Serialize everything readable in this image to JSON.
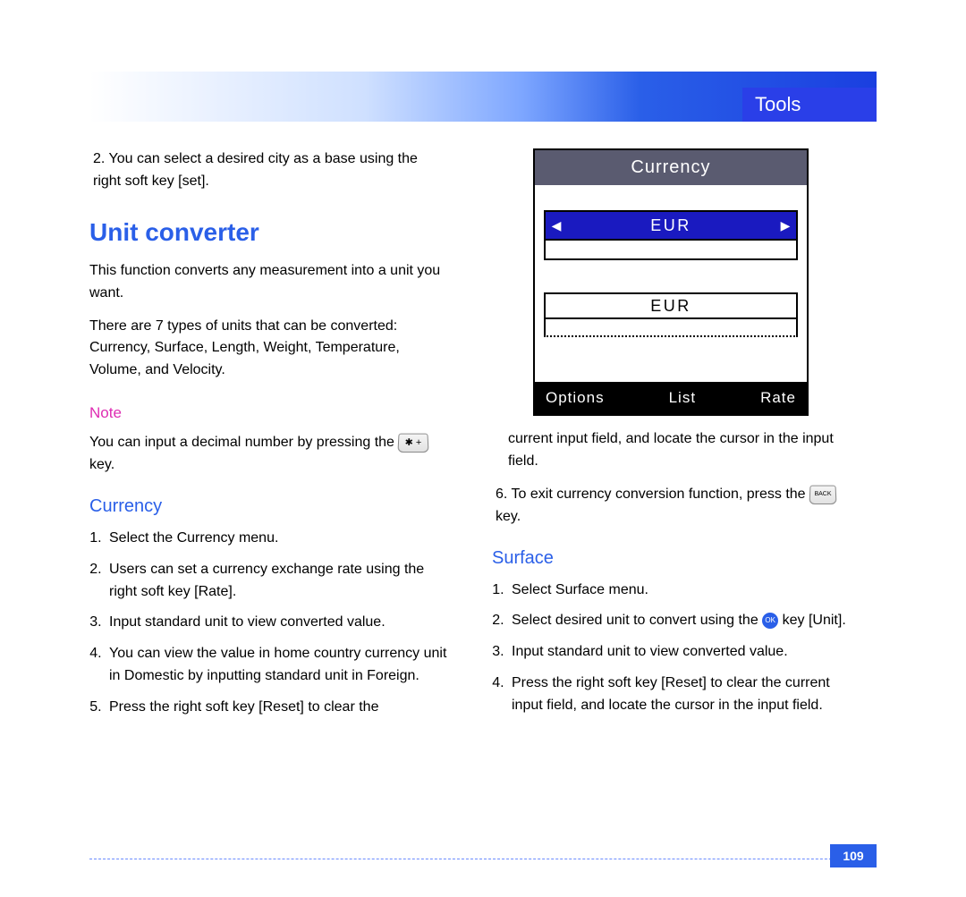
{
  "header": {
    "title": "Tools"
  },
  "page_number": "109",
  "left": {
    "step2": "You can select a desired city as a base using the right soft key [set].",
    "h1": "Unit converter",
    "p1": "This function converts any measurement into a unit you want.",
    "p2": "There are 7 types of units that can be converted: Currency, Surface, Length, Weight, Temperature, Volume, and Velocity.",
    "note_label": "Note",
    "note_text_a": "You can input a decimal number by pressing the ",
    "note_text_b": " key.",
    "h2_currency": "Currency",
    "currency_steps": [
      "Select the Currency menu.",
      "Users can set a currency exchange rate using the right soft key [Rate].",
      "Input standard unit to view converted value.",
      "You can view the value in home country currency unit in Domestic by inputting standard unit in Foreign.",
      "Press the right soft key [Reset] to clear the"
    ]
  },
  "right": {
    "phone": {
      "title": "Currency",
      "selected": "EUR",
      "output": "EUR",
      "soft_left": "Options",
      "soft_mid": "List",
      "soft_right": "Rate"
    },
    "cont5": "current input field, and locate the cursor in the input field.",
    "step6_a": "To exit currency conversion function, press the ",
    "step6_b": " key.",
    "h2_surface": "Surface",
    "surface_steps": {
      "s1": "Select Surface menu.",
      "s2_a": "Select desired unit to convert using the ",
      "s2_b": " key [Unit].",
      "s3": "Input standard unit to view converted value.",
      "s4": "Press the right soft key [Reset] to clear the current input field, and locate the cursor in the input field."
    }
  },
  "icons": {
    "star_key": "✱ +",
    "back_key": "BACK",
    "ok_key": "OK"
  }
}
